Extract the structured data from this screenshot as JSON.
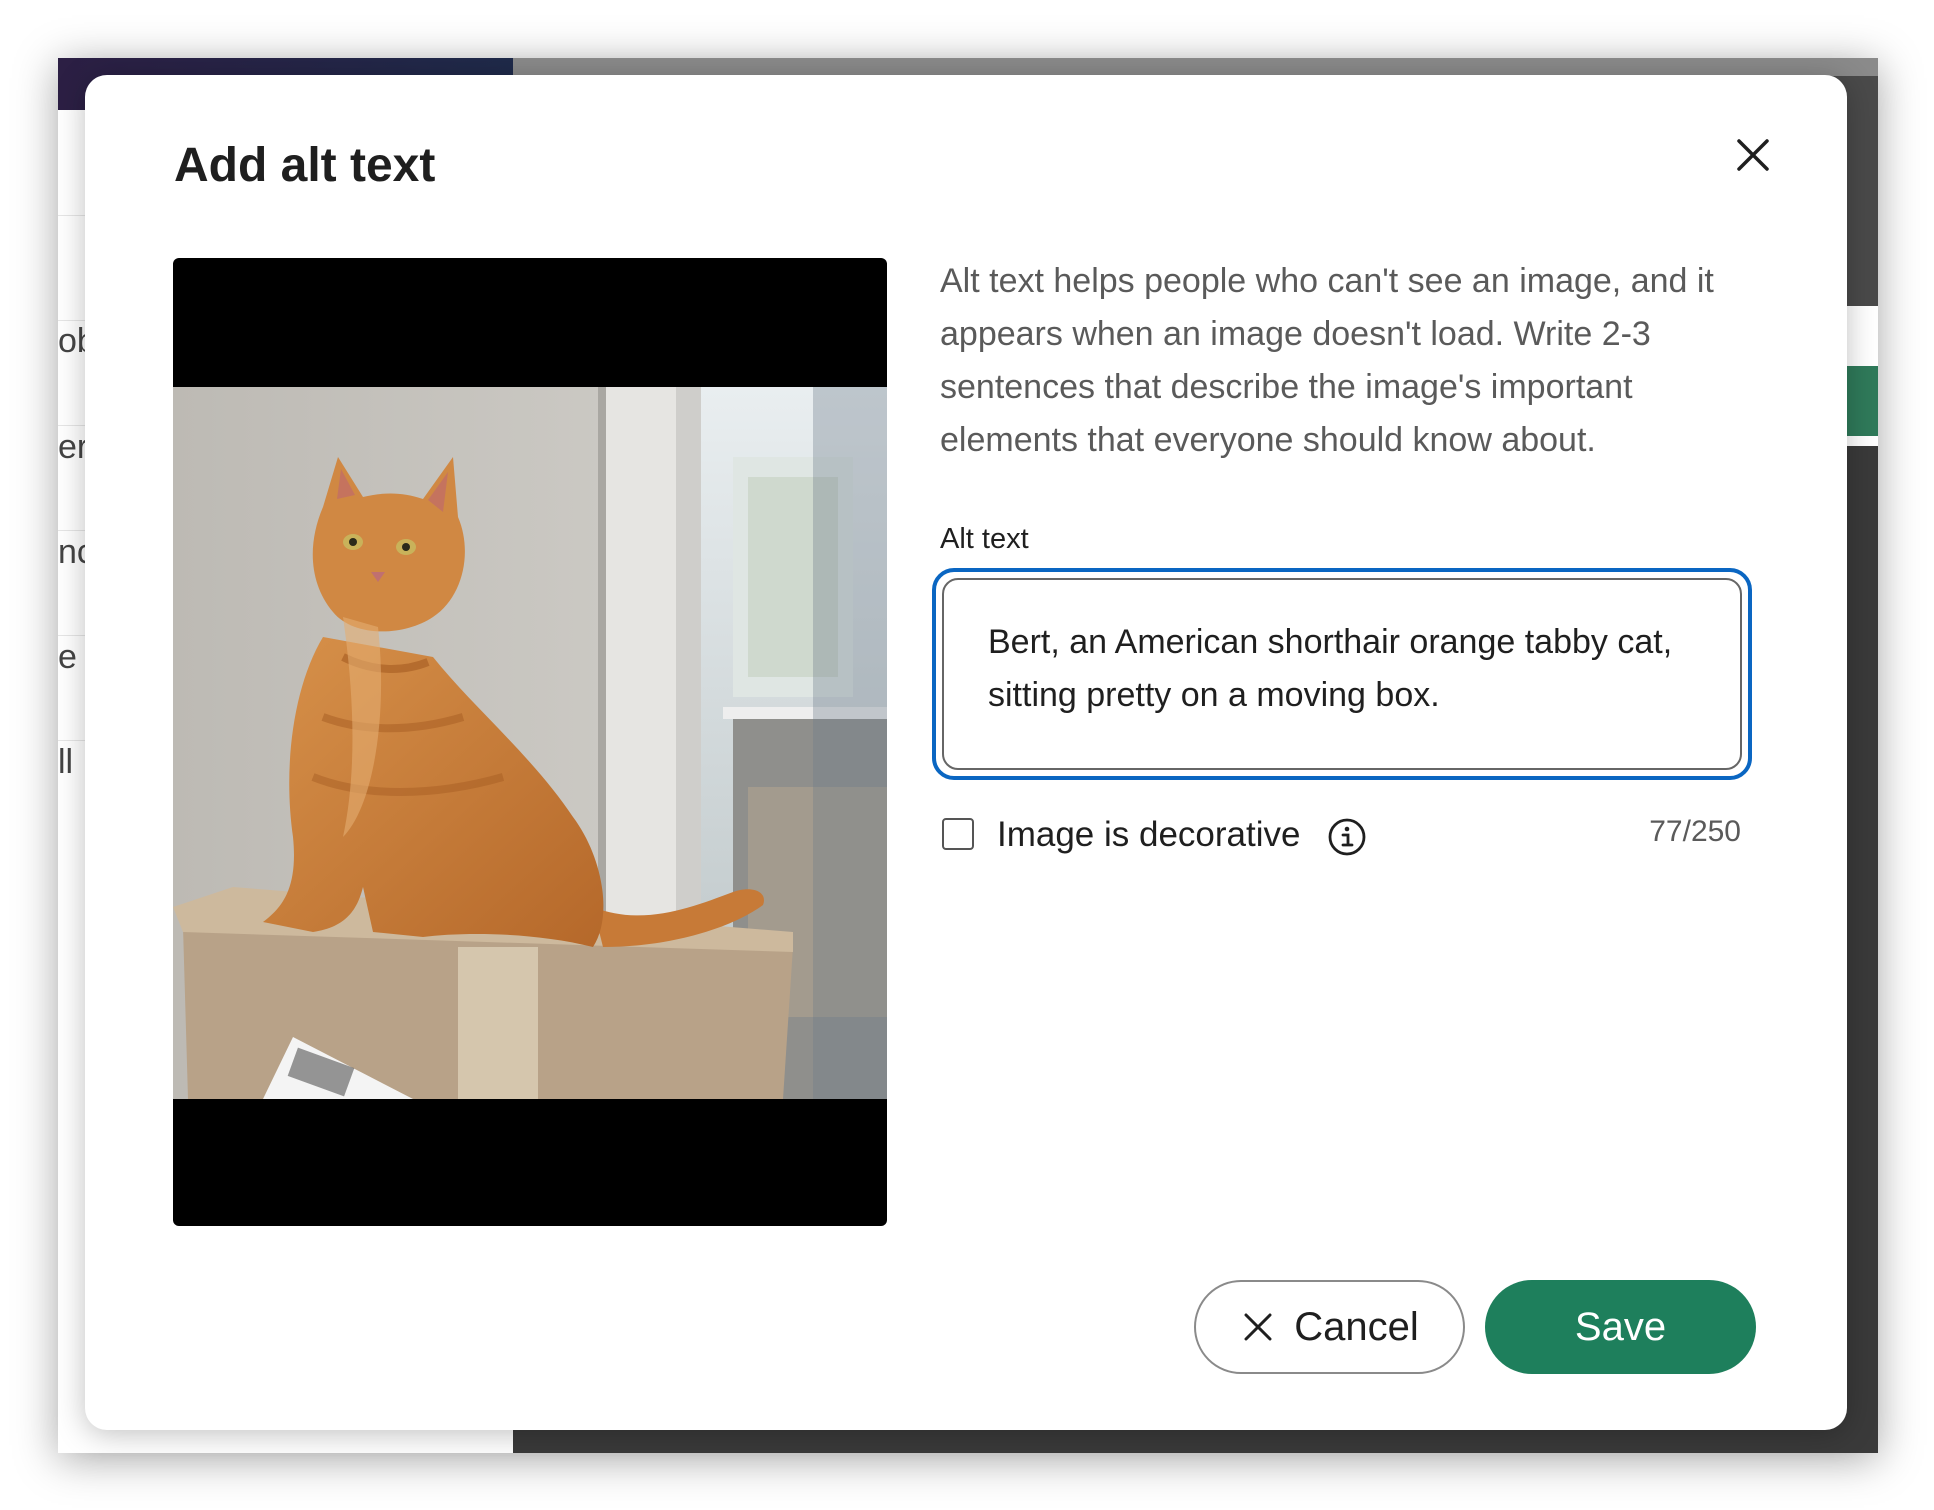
{
  "dialog": {
    "title": "Add alt text",
    "description": "Alt text helps people who can't see an image, and it appears when an image doesn't load. Write 2-3 sentences that describe the image's important elements that everyone should know about.",
    "field_label": "Alt text",
    "alt_text_value": "Bert, an American shorthair orange tabby cat, sitting pretty on a moving box.",
    "decorative_label": "Image is decorative",
    "decorative_checked": false,
    "char_count": "77/250",
    "cancel_label": "Cancel",
    "save_label": "Save"
  },
  "background_sidebar_fragments": [
    "ob",
    "er",
    "nc",
    "e",
    "ll"
  ],
  "icons": {
    "close": "close-icon",
    "info": "info-icon",
    "cancel": "close-icon"
  },
  "colors": {
    "primary": "#1e7f5c",
    "focus_ring": "#0a66c2",
    "text": "#1f1f1f",
    "muted_text": "#5a5a5a"
  }
}
